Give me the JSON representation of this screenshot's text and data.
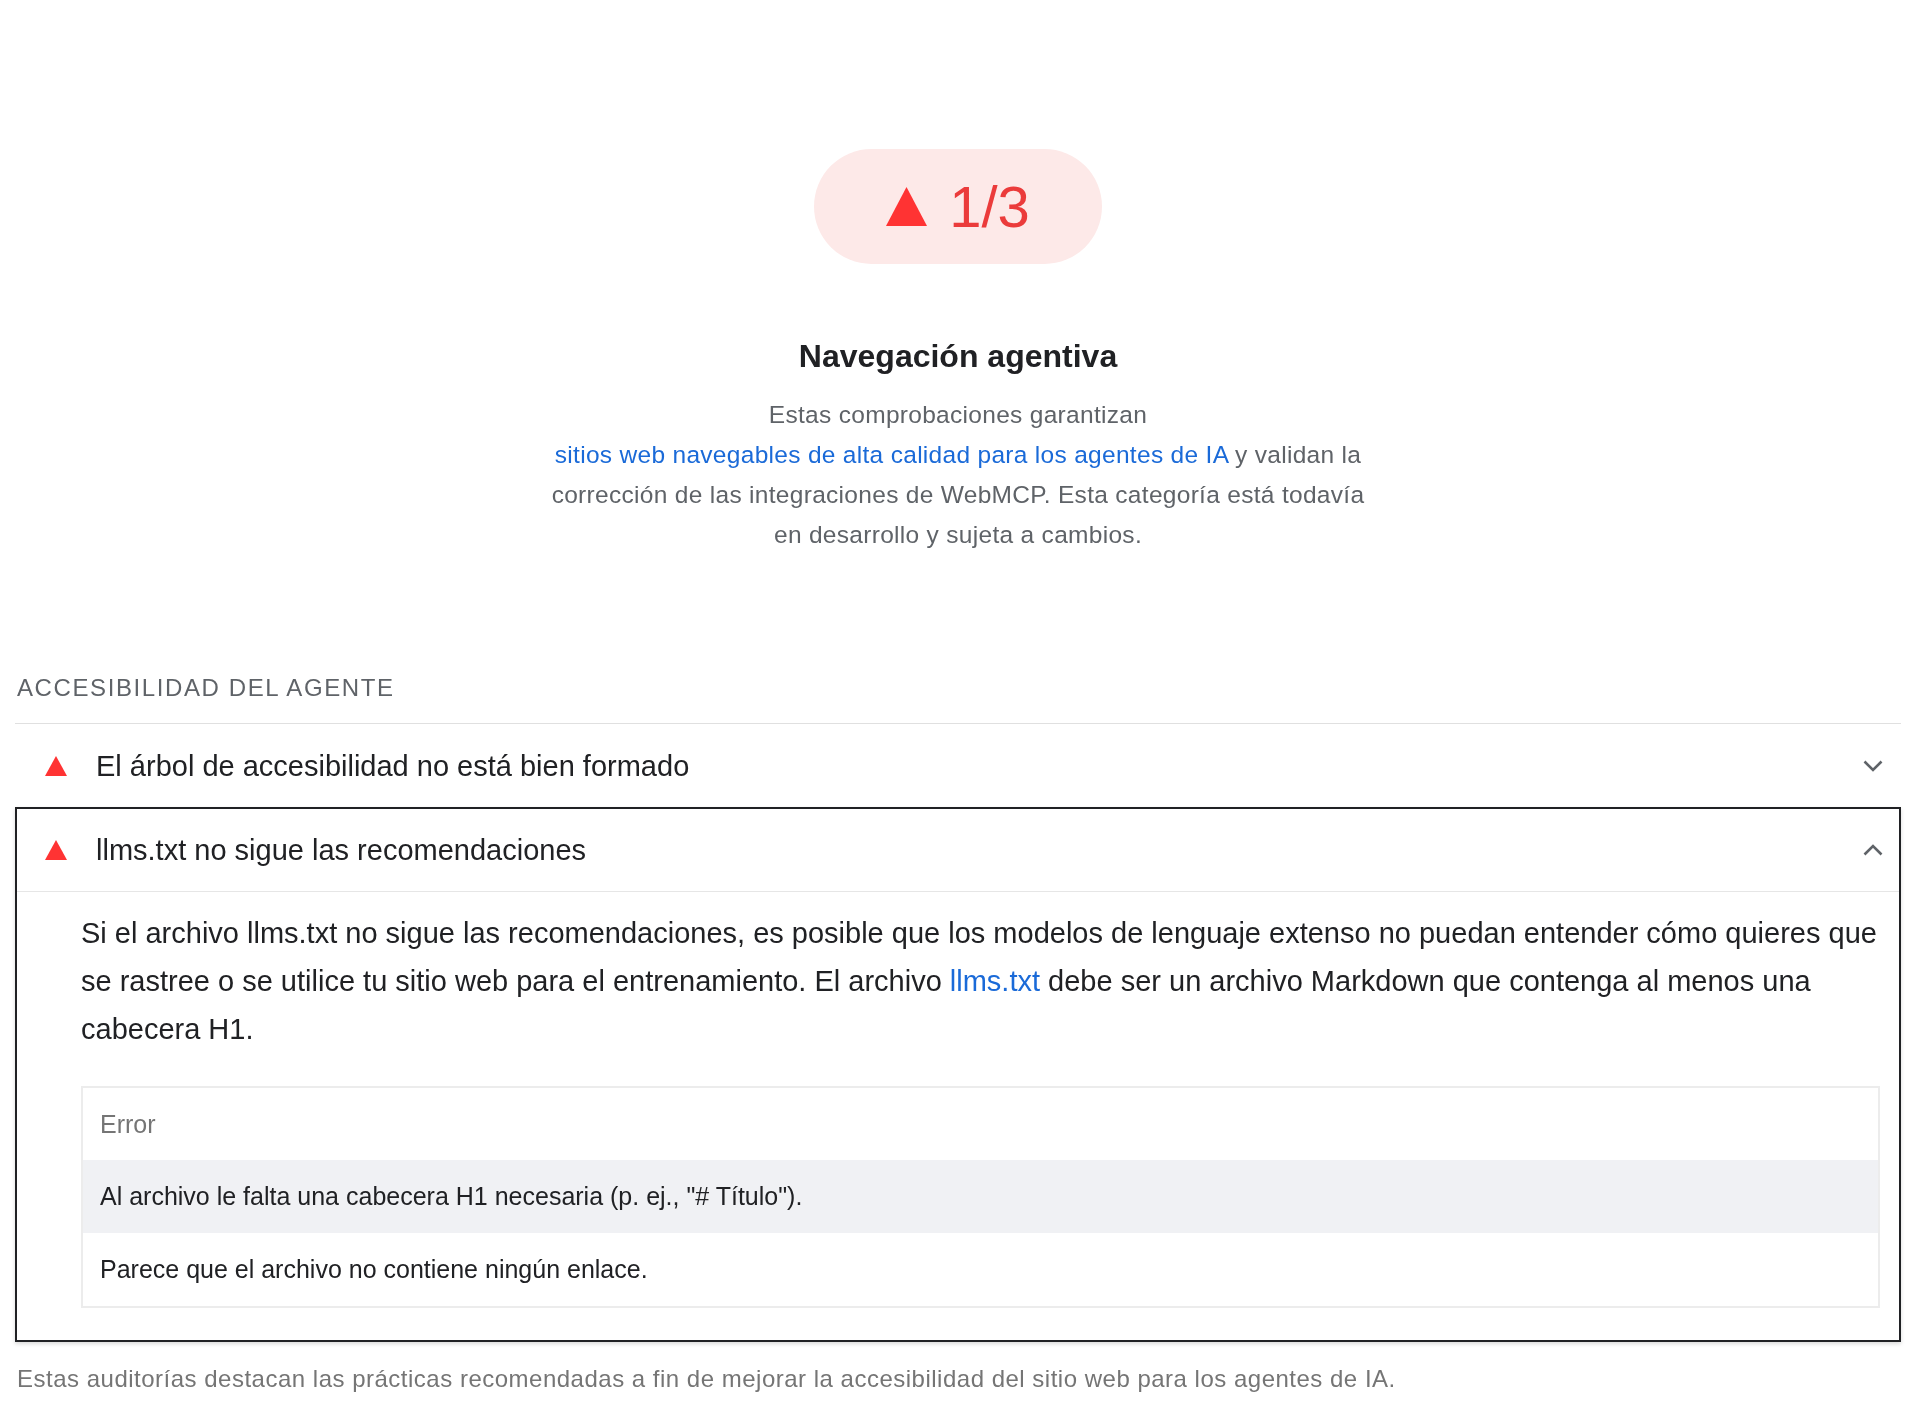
{
  "gauge": {
    "failed": true,
    "score": "1/3"
  },
  "category": {
    "title": "Navegación agentiva",
    "description": [
      {
        "kind": "text",
        "text": "Estas comprobaciones garantizan "
      },
      {
        "kind": "link",
        "text": "sitios web navegables de alta calidad para los agentes de IA"
      },
      {
        "kind": "text",
        "text": " y validan la corrección de las integraciones de WebMCP. Esta categoría está todavía en desarrollo y sujeta a cambios."
      }
    ]
  },
  "section": {
    "title": "ACCESIBILIDAD DEL AGENTE",
    "audits": [
      {
        "failed": true,
        "title": "El árbol de accesibilidad no está bien formado",
        "expanded": false
      },
      {
        "failed": true,
        "title": "llms.txt no sigue las recomendaciones",
        "expanded": true,
        "description": [
          {
            "kind": "text",
            "text": "Si el archivo llms.txt no sigue las recomendaciones, es posible que los modelos de lenguaje extenso no puedan entender cómo quieres que se rastree o se utilice tu sitio web para el entrenamiento. El archivo "
          },
          {
            "kind": "link",
            "text": "llms.txt"
          },
          {
            "kind": "text",
            "text": " debe ser un archivo Markdown que contenga al menos una cabecera H1."
          }
        ],
        "table": {
          "columns": [
            "Error"
          ],
          "rows": [
            [
              "Al archivo le falta una cabecera H1 necesaria (p. ej., \"# Título\")."
            ],
            [
              "Parece que el archivo no contiene ningún enlace."
            ]
          ]
        }
      }
    ],
    "footer": "Estas auditorías destacan las prácticas recomendadas a fin de mejorar la accesibilidad del sitio web para los agentes de IA."
  }
}
